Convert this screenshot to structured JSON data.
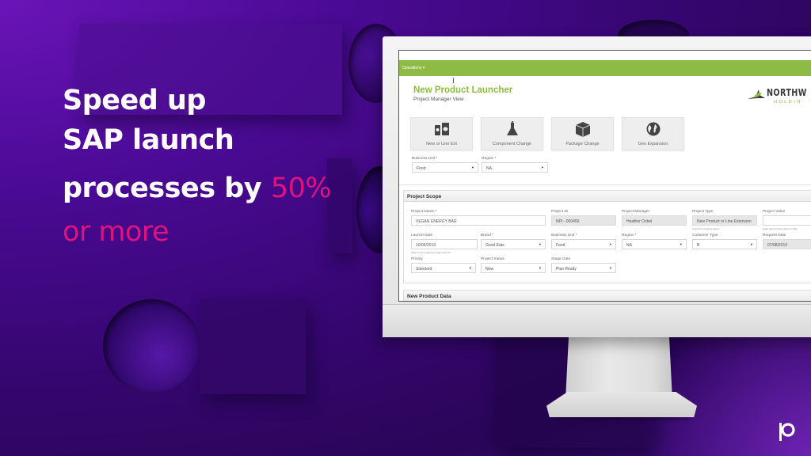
{
  "headline": {
    "line1": "Speed up",
    "line2": "SAP launch",
    "line3_prefix": "processes by",
    "line3_accent": "50%",
    "line4_accent": "or more",
    "accent_color": "#e0127f"
  },
  "app": {
    "menu_label": "Operations",
    "menu_caret": "▾",
    "title": "New Product Launcher",
    "subtitle": "Project Manager View",
    "brand_color": "#8dbb45",
    "logo": {
      "name": "NORTHW",
      "sub": "HOLDIN"
    },
    "tiles": [
      {
        "label": "New or Line Ext",
        "icon": "snack-products-icon"
      },
      {
        "label": "Component Change",
        "icon": "flask-icon"
      },
      {
        "label": "Package Change",
        "icon": "package-box-icon"
      },
      {
        "label": "Geo Expansion",
        "icon": "globe-icon"
      }
    ],
    "top_filters": {
      "business_unit": {
        "label": "Business Unit *",
        "value": "Food"
      },
      "region": {
        "label": "Region *",
        "value": "NA"
      }
    },
    "project_scope": {
      "heading": "Project Scope",
      "project_name": {
        "label": "Project Name *",
        "value": "VEGAN ENERGY BAR"
      },
      "project_id": {
        "label": "Project ID",
        "value": "NPI - 000459"
      },
      "project_manager": {
        "label": "Project Manager",
        "value": "Heather Oxbel"
      },
      "project_type": {
        "label": "Project Type",
        "value": "New Product or Line Extension",
        "hint": "select from buttons above"
      },
      "project_value": {
        "label": "Project Value",
        "value": "",
        "hint": "Enter approximate value in USD"
      },
      "launch_date": {
        "label": "Launch Date",
        "value": "10/06/2019",
        "hint": "When is the expected project launch?"
      },
      "brand": {
        "label": "Brand *",
        "value": "Good Eats"
      },
      "business_unit": {
        "label": "Business Unit *",
        "value": "Food"
      },
      "region": {
        "label": "Region *",
        "value": "NA"
      },
      "customer_type": {
        "label": "Customer Type",
        "value": "B"
      },
      "request_date": {
        "label": "Request Date",
        "value": "07/08/2019"
      },
      "priority": {
        "label": "Priority",
        "value": "Standard"
      },
      "project_status": {
        "label": "Project Status",
        "value": "New"
      },
      "stage_gate": {
        "label": "Stage Gate",
        "value": "Plan Ready"
      }
    },
    "new_product_data": {
      "heading": "New Product Data"
    },
    "dropdown_caret": "▾"
  },
  "corner_logo": "brand-p-logo"
}
